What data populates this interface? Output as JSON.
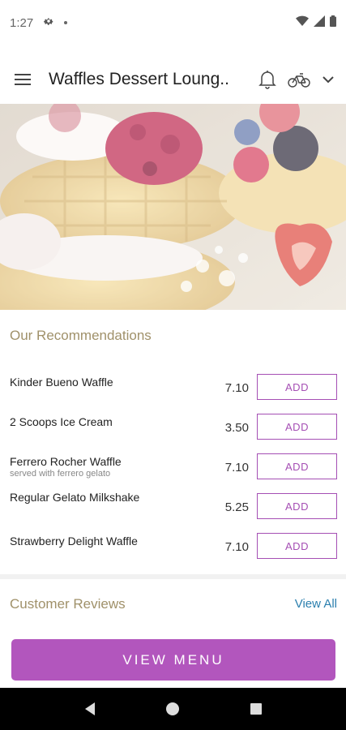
{
  "status_bar": {
    "time": "1:27",
    "icons": [
      "gear-icon",
      "dot-icon",
      "wifi-icon",
      "signal-icon",
      "battery-icon"
    ]
  },
  "app_bar": {
    "title": "Waffles Dessert Loung..",
    "icons": [
      "menu-icon",
      "bell-icon",
      "bicycle-icon",
      "chevron-down-icon"
    ]
  },
  "hero": {
    "description_icon": "waffle-photo"
  },
  "recommendations": {
    "title": "Our Recommendations",
    "items": [
      {
        "name": "Kinder Bueno Waffle",
        "subtitle": "",
        "price": "7.10",
        "button": "ADD"
      },
      {
        "name": "2 Scoops Ice Cream",
        "subtitle": "",
        "price": "3.50",
        "button": "ADD"
      },
      {
        "name": "Ferrero Rocher Waffle",
        "subtitle": "served with ferrero gelato",
        "price": "7.10",
        "button": "ADD"
      },
      {
        "name": "Regular Gelato Milkshake",
        "subtitle": "",
        "price": "5.25",
        "button": "ADD"
      },
      {
        "name": "Strawberry Delight Waffle",
        "subtitle": "",
        "price": "7.10",
        "button": "ADD"
      }
    ]
  },
  "reviews": {
    "title": "Customer Reviews",
    "view_all": "View All"
  },
  "cta": {
    "label": "VIEW MENU"
  },
  "nav_bar": {
    "icons": [
      "back-icon",
      "home-icon",
      "recents-icon"
    ]
  },
  "colors": {
    "accent": "#b256bd",
    "section_title": "#a0916a",
    "link": "#2b7fae"
  }
}
